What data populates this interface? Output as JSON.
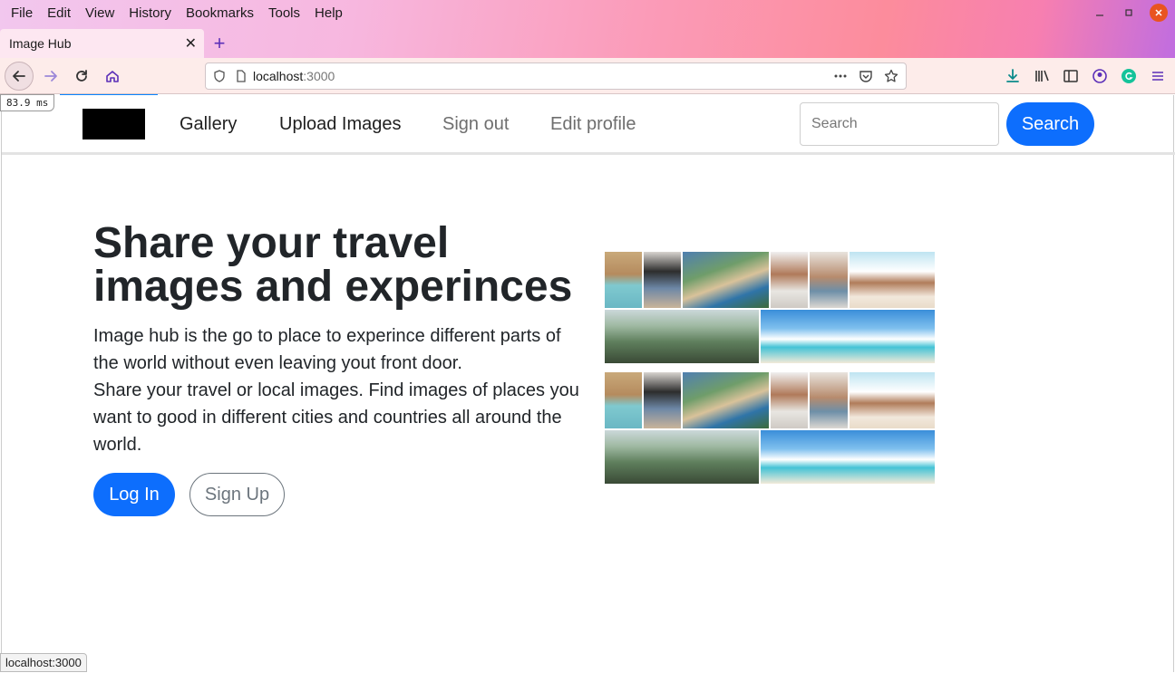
{
  "menubar": {
    "items": [
      {
        "label": "File"
      },
      {
        "label": "Edit"
      },
      {
        "label": "View"
      },
      {
        "label": "History"
      },
      {
        "label": "Bookmarks"
      },
      {
        "label": "Tools"
      },
      {
        "label": "Help"
      }
    ]
  },
  "tab": {
    "title": "Image Hub",
    "close_glyph": "✕",
    "new_tab_glyph": "+"
  },
  "urlbar": {
    "host": "localhost",
    "port": ":3000"
  },
  "timing": {
    "value": "83.9",
    "unit": "ms"
  },
  "site": {
    "nav": {
      "gallery": "Gallery",
      "upload": "Upload Images",
      "signout": "Sign out",
      "edit_profile": "Edit profile"
    },
    "search": {
      "placeholder": "Search",
      "button": "Search"
    },
    "hero": {
      "title": "Share your travel images and experinces",
      "paragraph_1": "Image hub is the go to place to experince different parts of the world without even leaving yout front door.",
      "paragraph_2": "Share your travel or local images. Find images of places you want to good in different cities and countries all around the world.",
      "login": "Log In",
      "signup": "Sign Up"
    }
  },
  "status_bar": {
    "url": "localhost:3000"
  },
  "colors": {
    "primary": "#0d6efd",
    "ubuntu_close": "#e95420",
    "progress": "#0a84ff"
  }
}
